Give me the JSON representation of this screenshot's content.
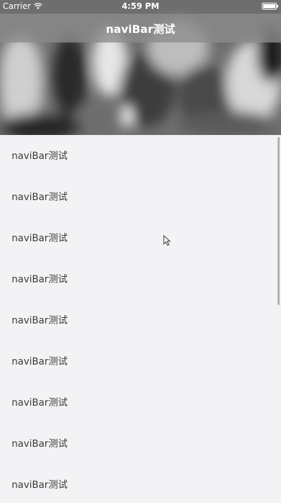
{
  "status_bar": {
    "carrier": "Carrier",
    "time": "4:59 PM",
    "battery_level": 1.0
  },
  "nav_bar": {
    "title": "naviBar测试"
  },
  "list": {
    "items": [
      {
        "label": "naviBar测试"
      },
      {
        "label": "naviBar测试"
      },
      {
        "label": "naviBar测试"
      },
      {
        "label": "naviBar测试"
      },
      {
        "label": "naviBar测试"
      },
      {
        "label": "naviBar测试"
      },
      {
        "label": "naviBar测试"
      },
      {
        "label": "naviBar测试"
      },
      {
        "label": "naviBar测试"
      }
    ]
  },
  "icons": {
    "wifi": "wifi-icon",
    "battery": "battery-icon",
    "cursor": "pointer-cursor-icon"
  },
  "colors": {
    "nav_bar_background": "#8c8c8c",
    "list_background": "#f3f3f5",
    "text": "#3a3a3a"
  }
}
